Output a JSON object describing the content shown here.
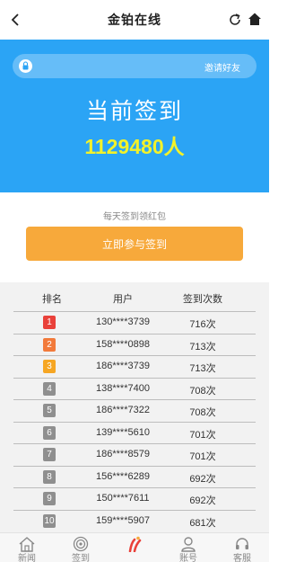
{
  "header": {
    "title": "金铂在线",
    "back_icon": "back-arrow-icon",
    "refresh_icon": "refresh-icon",
    "home_icon": "home-icon"
  },
  "banner": {
    "invite_label": "邀请好友",
    "lock_icon": "lock-icon"
  },
  "hero": {
    "label": "当前签到",
    "count": "1129480人",
    "background_color": "#2ba4f5",
    "count_color": "#f2f22a"
  },
  "checkin": {
    "tip": "每天签到领红包",
    "button_label": "立即参与签到",
    "button_color": "#f7a93b"
  },
  "leaderboard": {
    "columns": [
      "排名",
      "用户",
      "签到次数"
    ],
    "rows": [
      {
        "rank": "1",
        "user": "130****3739",
        "count": "716次",
        "badge_color": "#e9413a"
      },
      {
        "rank": "2",
        "user": "158****0898",
        "count": "713次",
        "badge_color": "#f27a3b"
      },
      {
        "rank": "3",
        "user": "186****3739",
        "count": "713次",
        "badge_color": "#f6a623"
      },
      {
        "rank": "4",
        "user": "138****7400",
        "count": "708次",
        "badge_color": "#8f8f8f"
      },
      {
        "rank": "5",
        "user": "186****7322",
        "count": "708次",
        "badge_color": "#8f8f8f"
      },
      {
        "rank": "6",
        "user": "139****5610",
        "count": "701次",
        "badge_color": "#8f8f8f"
      },
      {
        "rank": "7",
        "user": "186****8579",
        "count": "701次",
        "badge_color": "#8f8f8f"
      },
      {
        "rank": "8",
        "user": "156****6289",
        "count": "692次",
        "badge_color": "#8f8f8f"
      },
      {
        "rank": "9",
        "user": "150****7611",
        "count": "692次",
        "badge_color": "#8f8f8f"
      },
      {
        "rank": "10",
        "user": "159****5907",
        "count": "681次",
        "badge_color": "#8f8f8f"
      }
    ]
  },
  "tabbar": {
    "tabs": [
      {
        "label": "新闻",
        "icon": "house-icon"
      },
      {
        "label": "签到",
        "icon": "target-icon"
      },
      {
        "label": "",
        "icon": "brand-logo-icon"
      },
      {
        "label": "账号",
        "icon": "user-icon"
      },
      {
        "label": "客服",
        "icon": "headset-icon"
      }
    ]
  }
}
